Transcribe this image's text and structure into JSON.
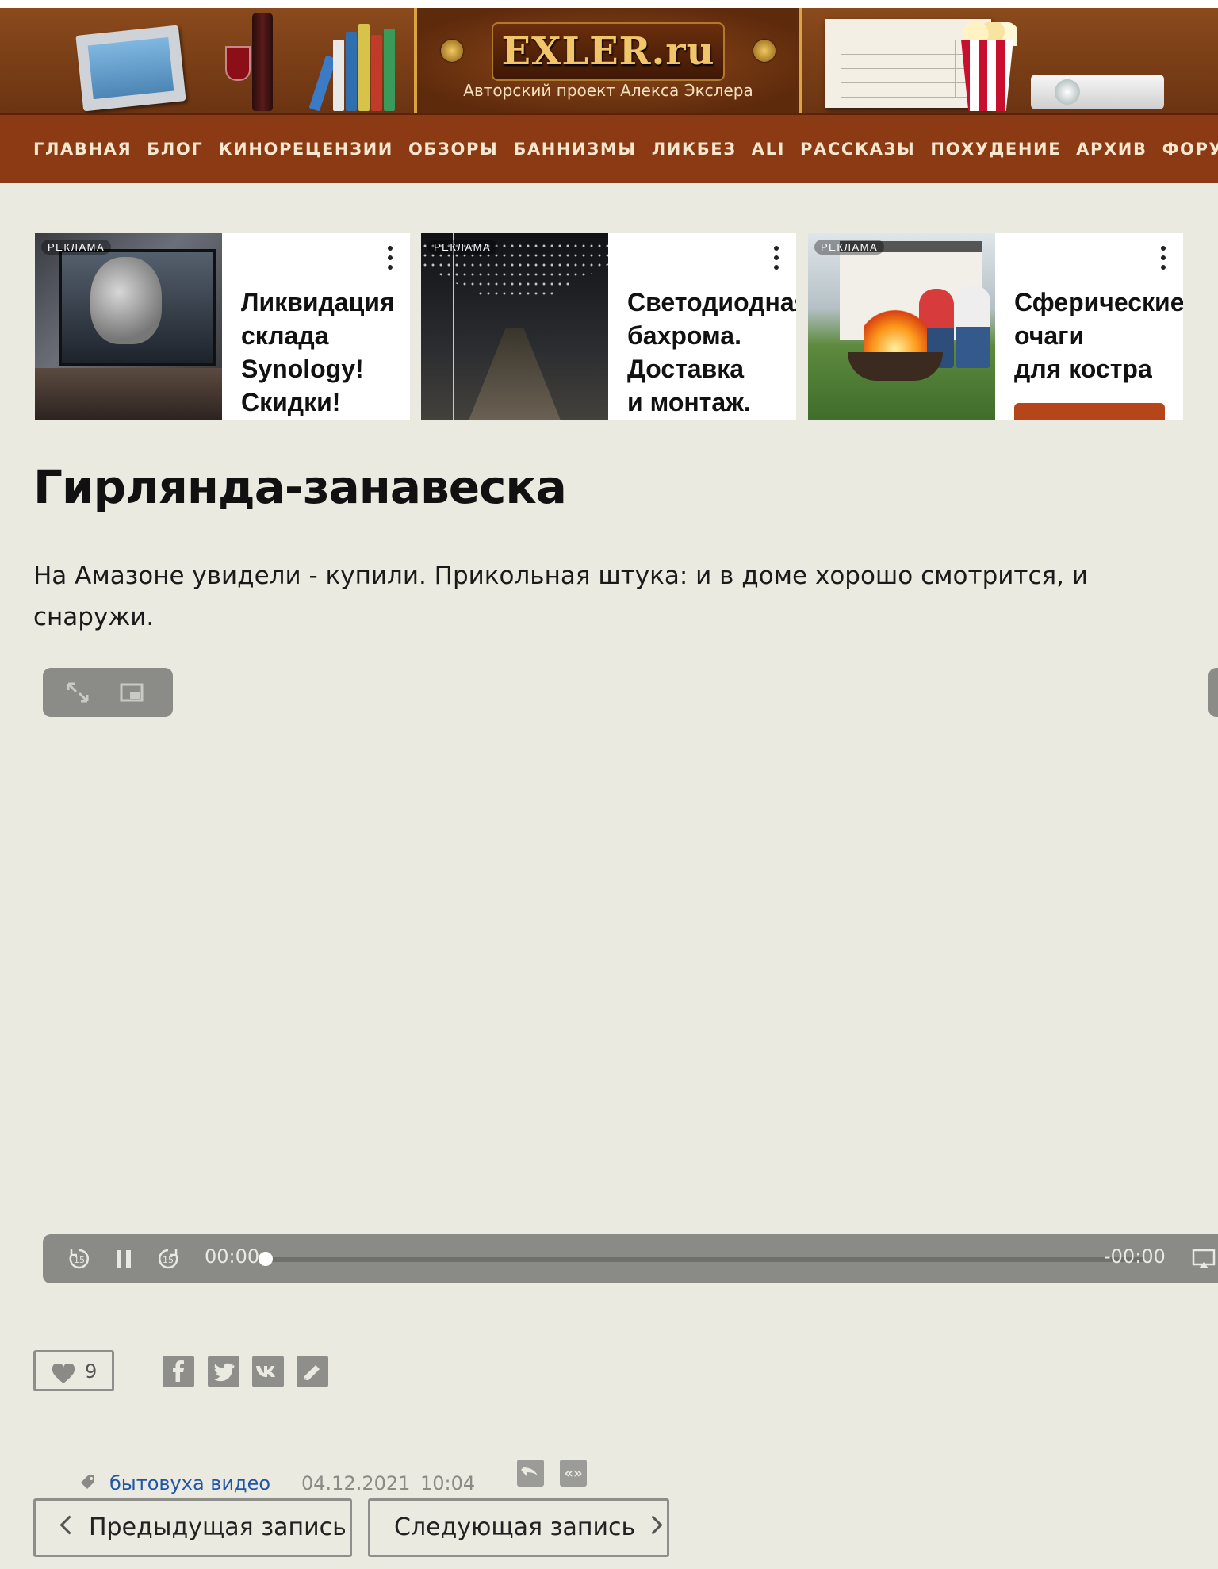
{
  "header": {
    "logo": "EXLER.ru",
    "tagline": "Авторский проект Алекса Экслера"
  },
  "nav": {
    "items": [
      "ГЛАВНАЯ",
      "БЛОГ",
      "КИНОРЕЦЕНЗИИ",
      "ОБЗОРЫ",
      "БАННИЗМЫ",
      "ЛИКБЕЗ",
      "ALI",
      "РАССКАЗЫ",
      "ПОХУДЕНИЕ",
      "АРХИВ",
      "ФОРУМ"
    ],
    "external_icon": "external-link-icon"
  },
  "ads": [
    {
      "badge": "РЕКЛАМА",
      "title": "Ликвидация\nсклада\nSynology!\nСкидки!"
    },
    {
      "badge": "РЕКЛАМА",
      "title": "Светодиодная\nбахрома.\nДоставка\nи монтаж."
    },
    {
      "badge": "РЕКЛАМА",
      "title": "Сферические\nочаги\nдля костра"
    }
  ],
  "article": {
    "title": "Гирлянда-занавеска",
    "intro": "На Амазоне увидели - купили. Прикольная штука: и в доме хорошо смотрится, и снаружи."
  },
  "video_toolbar": {
    "fullscreen_icon": "expand-icon",
    "pip_icon": "picture-in-picture-icon"
  },
  "player": {
    "time_elapsed": "00:00",
    "time_remaining": "-00:00",
    "progress": 0,
    "rewind_icon": "rewind-15-icon",
    "pause_icon": "pause-icon",
    "forward_icon": "forward-15-icon",
    "airplay_icon": "airplay-icon"
  },
  "reactions": {
    "likes": "9",
    "share_icons": [
      "facebook-icon",
      "twitter-icon",
      "vk-icon",
      "livejournal-icon"
    ]
  },
  "meta": {
    "tags": "бытовуха видео",
    "date": "04.12.2021",
    "time": "10:04"
  },
  "pager": {
    "prev": "Предыдущая запись",
    "next": "Следующая запись"
  },
  "colors": {
    "background": "#ebeae0",
    "nav": "#8c3a14",
    "accent_cta": "#b5461a",
    "link": "#1f56a8"
  }
}
